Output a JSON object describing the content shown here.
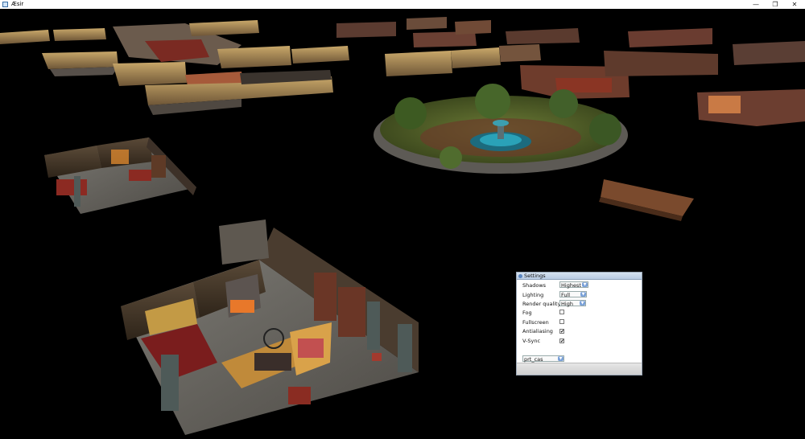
{
  "window": {
    "title": "Æsir",
    "icon": "app-icon",
    "controls": [
      {
        "name": "minimize-button",
        "glyph": "—"
      },
      {
        "name": "maximize-button",
        "glyph": "❐"
      },
      {
        "name": "close-button",
        "glyph": "✕"
      }
    ]
  },
  "settings": {
    "title": "Settings",
    "shadows": {
      "label": "Shadows",
      "value": "Highest"
    },
    "lighting": {
      "label": "Lighting",
      "value": "Full"
    },
    "render_quality": {
      "label": "Render quality",
      "value": "High"
    },
    "fog": {
      "label": "Fog",
      "checked": false
    },
    "fullscreen": {
      "label": "Fullscreen",
      "checked": false
    },
    "antialiasing": {
      "label": "Antialiasing",
      "checked": true
    },
    "vsync": {
      "label": "V-Sync",
      "checked": true
    },
    "scene": {
      "value": "prt_cas"
    }
  },
  "colors": {
    "accent": "#7aa1d8",
    "titlebar": "#ffffff",
    "background": "#000000"
  }
}
